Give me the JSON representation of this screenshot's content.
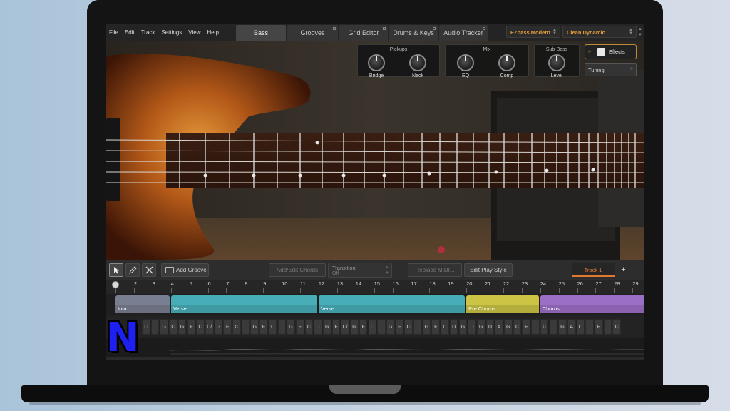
{
  "menu": [
    "File",
    "Edit",
    "Track",
    "Settings",
    "View",
    "Help"
  ],
  "tabs": [
    {
      "label": "Bass",
      "active": true
    },
    {
      "label": "Grooves",
      "active": false
    },
    {
      "label": "Grid Editor",
      "active": false
    },
    {
      "label": "Drums & Keys",
      "active": false
    },
    {
      "label": "Audio Tracker",
      "active": false
    }
  ],
  "presets": {
    "instrument": "EZbass Modern",
    "sound": "Clean Dynamic"
  },
  "panels": {
    "pickups": {
      "title": "Pickups",
      "knobs": [
        "Bridge",
        "Neck"
      ]
    },
    "mix": {
      "title": "Mix",
      "knobs": [
        "EQ",
        "Comp"
      ]
    },
    "subbass": {
      "title": "Sub-Bass",
      "knobs": [
        "Level"
      ]
    }
  },
  "effects_label": "Effects",
  "tuning_label": "Tuning",
  "toolbar": {
    "add_groove": "Add Groove",
    "add_edit_chords": "Add/Edit Chords",
    "transition_label": "Transition",
    "transition_value": "Off",
    "replace_midi": "Replace MIDI...",
    "edit_play_style": "Edit Play Style",
    "track_name": "Track 1",
    "add_track": "+"
  },
  "ruler": [
    "1",
    "2",
    "3",
    "4",
    "5",
    "6",
    "7",
    "8",
    "9",
    "10",
    "11",
    "12",
    "13",
    "14",
    "15",
    "16",
    "17",
    "18",
    "19",
    "20",
    "21",
    "22",
    "23",
    "24",
    "25",
    "26",
    "27",
    "28",
    "29"
  ],
  "parts": [
    {
      "name": "Intro",
      "color": "#6b6f7f"
    },
    {
      "name": "Verse",
      "color": "#3f9aa3"
    },
    {
      "name": "Verse",
      "color": "#3f9aa3"
    },
    {
      "name": "Pre Chorus",
      "color": "#b3ad3c"
    },
    {
      "name": "Chorus",
      "color": "#8a62b0"
    }
  ],
  "chords": [
    "C",
    "",
    "G",
    "C",
    "G",
    "F",
    "C",
    "C/",
    "G",
    "F",
    "C",
    "",
    "G",
    "F",
    "C",
    "",
    "G",
    "F",
    "C",
    "C",
    "G",
    "F",
    "C/",
    "G",
    "F",
    "C",
    "",
    "G",
    "F",
    "C",
    "",
    "G",
    "F",
    "C",
    "D",
    "G",
    "D",
    "G",
    "D",
    "A",
    "G",
    "C",
    "F",
    "",
    "C",
    "",
    "G",
    "A",
    "C",
    "",
    "F",
    "",
    "C"
  ],
  "logo": "N"
}
